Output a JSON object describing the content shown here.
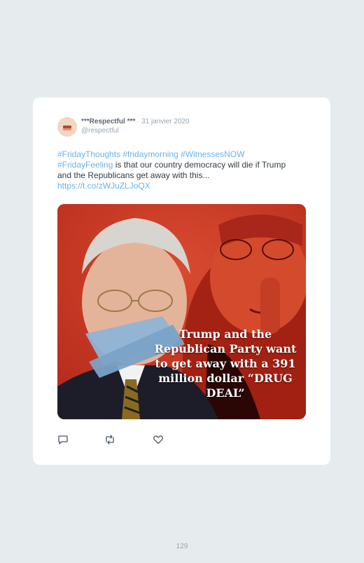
{
  "tweet": {
    "display_name": "***Respectful ***",
    "date": " · 31 janvier 2020",
    "handle": "@respectful",
    "hashtags_line1": "#FridayThoughts #fridaymorning #WitnessesNOW",
    "hashtag_line2": "#FridayFeeling",
    "text": " is that our country democracy will die if Trump and the Republicans get away with this...",
    "link": "https://t.co/zWJuZLJoQX",
    "image_caption": "Trump and the Republican Party want to get away with a 391 million dollar “DRUG DEAL”"
  },
  "actions": {
    "reply_icon": "reply-icon",
    "retweet_icon": "retweet-icon",
    "like_icon": "heart-icon"
  },
  "page_number": "129",
  "colors": {
    "background": "#e6ebee",
    "card": "#ffffff",
    "link": "#6ab2e7",
    "image_red": "#c8321e"
  }
}
